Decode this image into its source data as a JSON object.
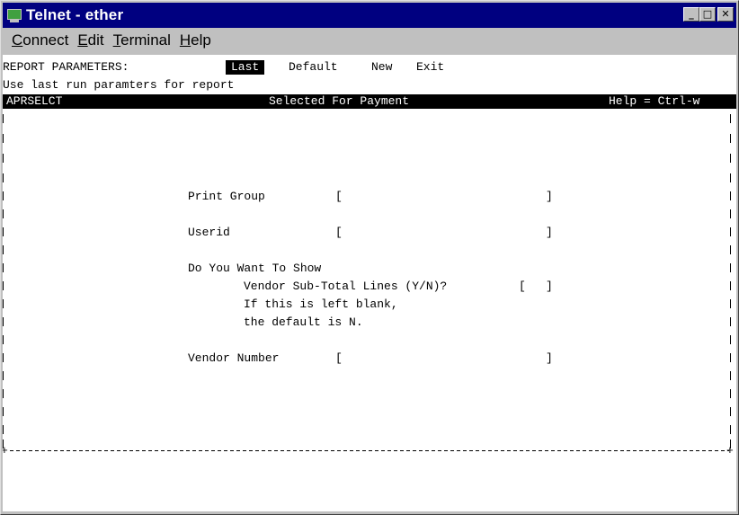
{
  "window": {
    "title": "Telnet - ether",
    "controls": {
      "minimize": "_",
      "maximize": "□",
      "close": "✕"
    }
  },
  "menubar": {
    "items": [
      {
        "key": "C",
        "rest": "onnect"
      },
      {
        "key": "E",
        "rest": "dit"
      },
      {
        "key": "T",
        "rest": "erminal"
      },
      {
        "key": "H",
        "rest": "elp"
      }
    ]
  },
  "terminal": {
    "report_params_label": "REPORT PARAMETERS:",
    "options": {
      "last": "Last",
      "default": "Default",
      "new": "New",
      "exit": "Exit"
    },
    "hint": "Use last run paramters for report",
    "header": {
      "program": "APRSELCT",
      "screen_title": "Selected For Payment",
      "help": "Help = Ctrl-w"
    },
    "fields": {
      "print_group": {
        "label": "Print Group",
        "open": "[",
        "close": "]",
        "value": ""
      },
      "userid": {
        "label": "Userid",
        "open": "[",
        "close": "]",
        "value": ""
      },
      "show_question": "Do You Want To Show",
      "vendor_subtotal": {
        "label": "Vendor Sub-Total Lines (Y/N)?",
        "open": "[",
        "close": "]",
        "value": ""
      },
      "blank_note_1": "If this is left blank,",
      "blank_note_2": "the default is N.",
      "vendor_number": {
        "label": "Vendor Number",
        "open": "[",
        "close": "]",
        "value": ""
      }
    },
    "border_corner": "+"
  }
}
